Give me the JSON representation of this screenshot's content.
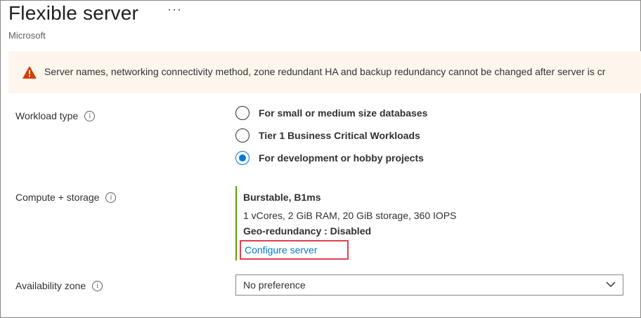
{
  "header": {
    "title": "Flexible server",
    "more_label": "···",
    "subtitle": "Microsoft"
  },
  "warning": {
    "icon": "warning-icon",
    "text": "Server names, networking connectivity method, zone redundant HA and backup redundancy cannot be changed after server is cr"
  },
  "workload": {
    "label": "Workload type",
    "options": [
      {
        "label": "For small or medium size databases",
        "checked": false
      },
      {
        "label": "Tier 1 Business Critical Workloads",
        "checked": false
      },
      {
        "label": "For development or hobby projects",
        "checked": true
      }
    ]
  },
  "compute": {
    "label": "Compute + storage",
    "tier": "Burstable, B1ms",
    "specs": "1 vCores, 2 GiB RAM, 20 GiB storage, 360 IOPS",
    "geo": "Geo-redundancy : Disabled",
    "configure_link": "Configure server"
  },
  "availability": {
    "label": "Availability zone",
    "selected": "No preference"
  },
  "colors": {
    "accent": "#0078d4",
    "warning_bg": "#fdf6ed",
    "warning_icon": "#d83b01",
    "compute_border": "#57a300",
    "highlight_border": "#e0404d"
  }
}
